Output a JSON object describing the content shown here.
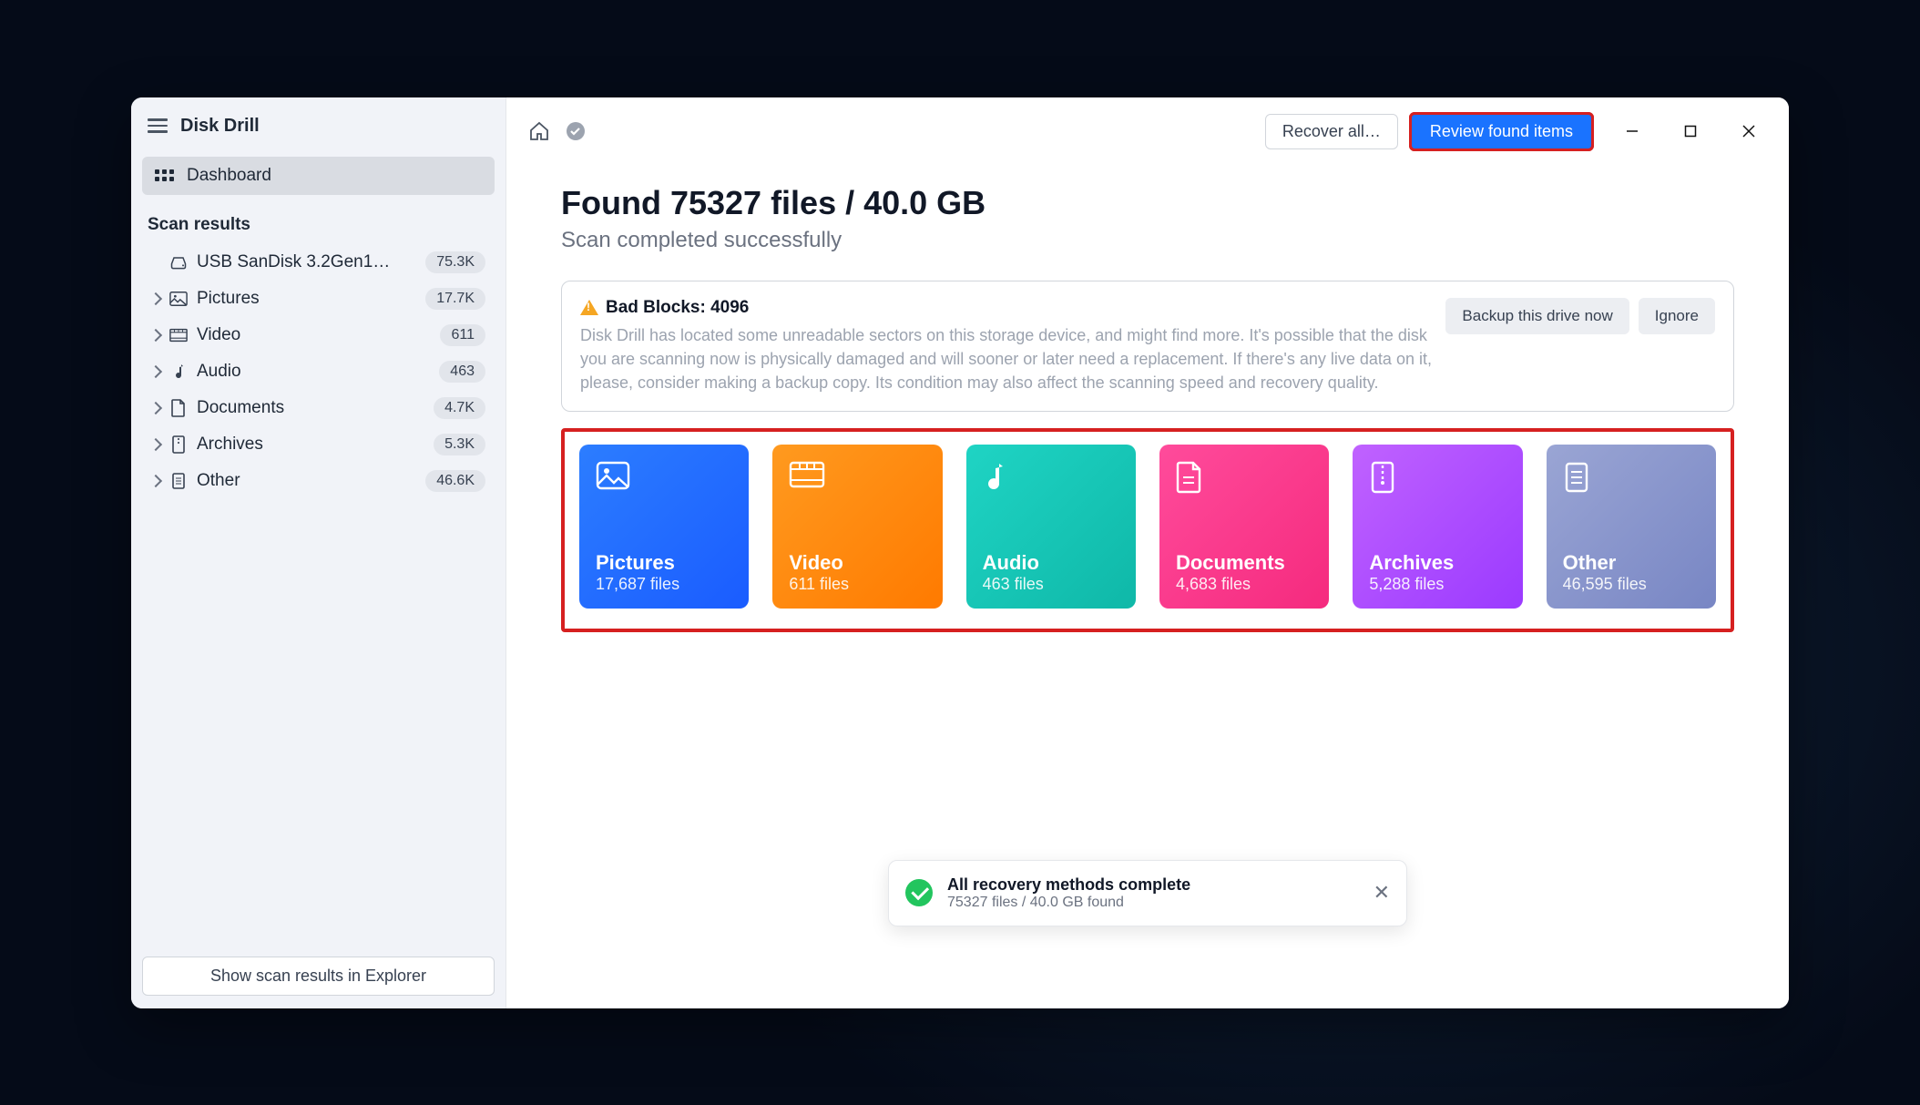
{
  "app": {
    "title": "Disk Drill"
  },
  "sidebar": {
    "dashboard_label": "Dashboard",
    "section_title": "Scan results",
    "device": {
      "label": "USB  SanDisk 3.2Gen1…",
      "badge": "75.3K"
    },
    "categories": [
      {
        "label": "Pictures",
        "badge": "17.7K"
      },
      {
        "label": "Video",
        "badge": "611"
      },
      {
        "label": "Audio",
        "badge": "463"
      },
      {
        "label": "Documents",
        "badge": "4.7K"
      },
      {
        "label": "Archives",
        "badge": "5.3K"
      },
      {
        "label": "Other",
        "badge": "46.6K"
      }
    ],
    "footer_button": "Show scan results in Explorer"
  },
  "toolbar": {
    "recover_all": "Recover all…",
    "review_found": "Review found items"
  },
  "results": {
    "heading": "Found 75327 files / 40.0 GB",
    "subheading": "Scan completed successfully"
  },
  "alert": {
    "title": "Bad Blocks: 4096",
    "body": "Disk Drill has located some unreadable sectors on this storage device, and might find more. It's possible that the disk you are scanning now is physically damaged and will sooner or later need a replacement. If there's any live data on it, please, consider making a backup copy. Its condition may also affect the scanning speed and recovery quality.",
    "backup_btn": "Backup this drive now",
    "ignore_btn": "Ignore"
  },
  "tiles": [
    {
      "name": "Pictures",
      "count": "17,687 files"
    },
    {
      "name": "Video",
      "count": "611 files"
    },
    {
      "name": "Audio",
      "count": "463 files"
    },
    {
      "name": "Documents",
      "count": "4,683 files"
    },
    {
      "name": "Archives",
      "count": "5,288 files"
    },
    {
      "name": "Other",
      "count": "46,595 files"
    }
  ],
  "toast": {
    "title": "All recovery methods complete",
    "sub": "75327 files / 40.0 GB found"
  }
}
